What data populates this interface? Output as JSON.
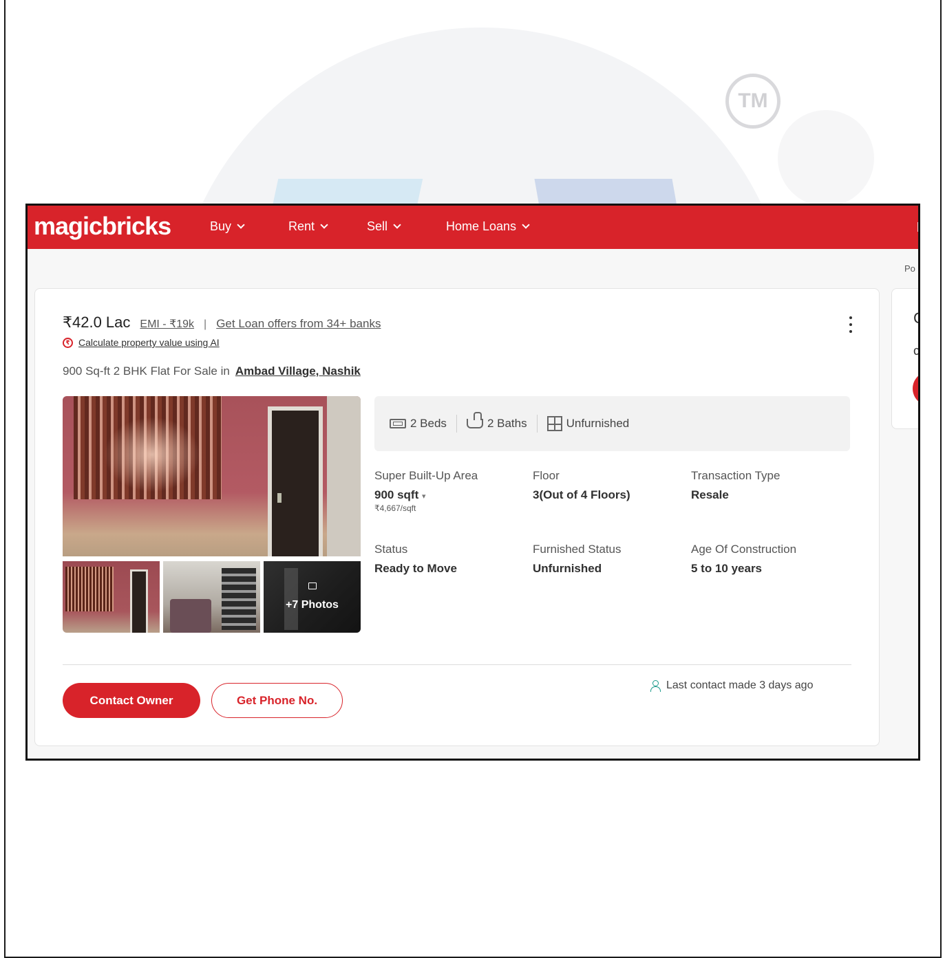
{
  "watermark": {
    "tm": "TM"
  },
  "app": {
    "logo": "magicbricks",
    "nav": [
      {
        "label": "Buy"
      },
      {
        "label": "Rent"
      },
      {
        "label": "Sell"
      },
      {
        "label": "Home Loans"
      }
    ],
    "breadcrumb_fragment": "Po"
  },
  "listing": {
    "price": "₹42.0 Lac",
    "emi": "EMI - ₹19k",
    "separator": "|",
    "loan_offer": "Get Loan offers from 34+ banks",
    "calculate_link": "Calculate property value using AI",
    "title_prefix": "900 Sq-ft 2 BHK Flat For Sale in",
    "locality": "Ambad Village, Nashik",
    "photos_more": "+7 Photos",
    "amenities": [
      {
        "icon": "bed-icon",
        "label": "2 Beds"
      },
      {
        "icon": "bath-icon",
        "label": "2 Baths"
      },
      {
        "icon": "furniture-icon",
        "label": "Unfurnished"
      }
    ],
    "specs": {
      "area": {
        "label": "Super Built-Up Area",
        "value": "900 sqft",
        "sub": "₹4,667/sqft"
      },
      "floor": {
        "label": "Floor",
        "value": "3(Out of 4 Floors)"
      },
      "transaction": {
        "label": "Transaction Type",
        "value": "Resale"
      },
      "status": {
        "label": "Status",
        "value": "Ready to Move"
      },
      "furnished": {
        "label": "Furnished Status",
        "value": "Unfurnished"
      },
      "age": {
        "label": "Age Of Construction",
        "value": "5 to 10 years"
      }
    },
    "contact_owner": "Contact Owner",
    "get_phone": "Get Phone No.",
    "last_contact": "Last contact made 3 days ago"
  },
  "colors": {
    "brand": "#d8232a",
    "accent_user_icon": "#1a9a8a"
  }
}
